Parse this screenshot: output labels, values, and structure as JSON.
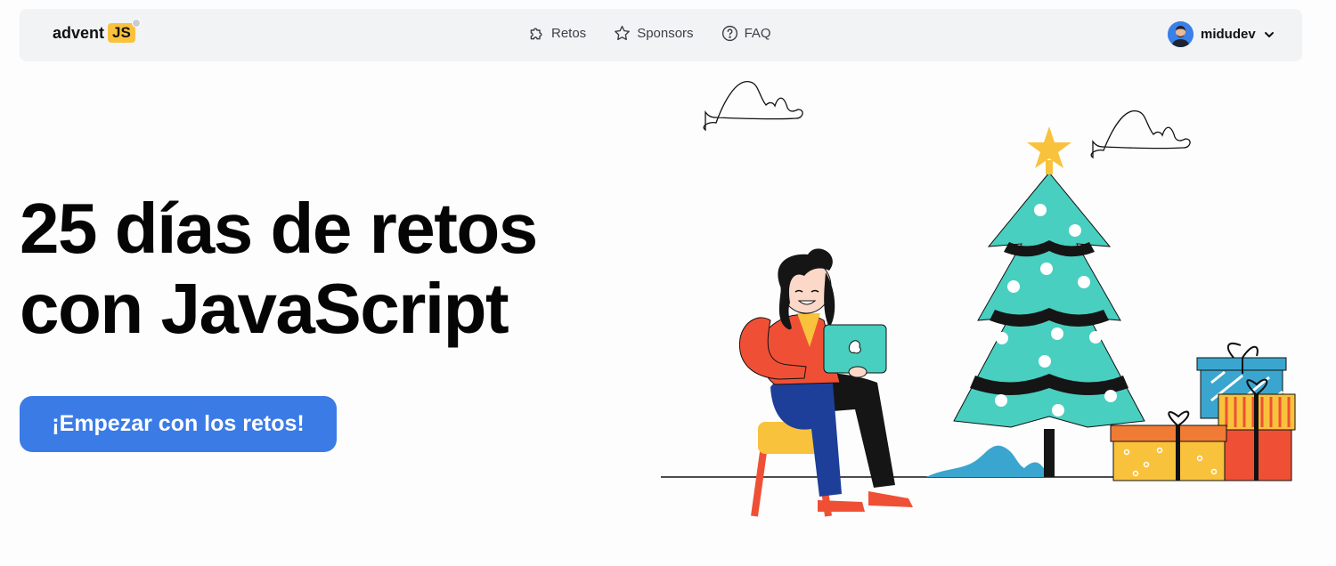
{
  "logo": {
    "text": "advent",
    "badge": "JS"
  },
  "nav": {
    "links": [
      {
        "label": "Retos",
        "icon": "puzzle-icon"
      },
      {
        "label": "Sponsors",
        "icon": "star-icon"
      },
      {
        "label": "FAQ",
        "icon": "question-circle-icon"
      }
    ]
  },
  "user": {
    "name": "midudev",
    "avatar_color": "#3a80e8"
  },
  "hero": {
    "title_line1": "25 días de retos",
    "title_line2": "con JavaScript",
    "cta_label": "¡Empezar con los retos!"
  },
  "colors": {
    "accent": "#3b7be6",
    "navbar_bg": "#f2f3f5",
    "logo_badge": "#f9c23c",
    "tree": "#48cfc0"
  }
}
